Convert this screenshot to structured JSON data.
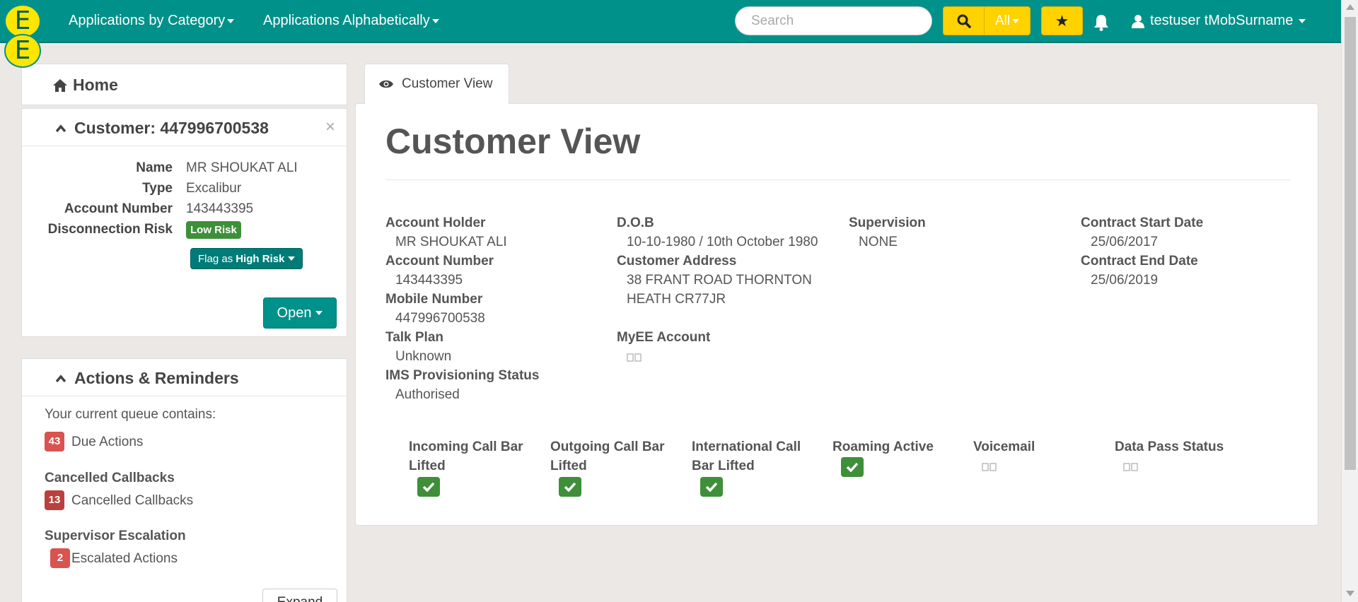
{
  "navbar": {
    "apps_by_category": "Applications by Category",
    "apps_alphabetically": "Applications Alphabetically",
    "search_placeholder": "Search",
    "search_scope": "All",
    "user_name": "testuser tMobSurname",
    "logo_letter": "E"
  },
  "home": {
    "label": "Home"
  },
  "customer": {
    "title": "Customer: 447996700538",
    "fields": [
      {
        "label": "Name",
        "value": "MR SHOUKAT ALI"
      },
      {
        "label": "Type",
        "value": "Excalibur"
      },
      {
        "label": "Account Number",
        "value": "143443395"
      },
      {
        "label": "Disconnection Risk",
        "value": "Low Risk"
      }
    ],
    "flag_prefix": "Flag as",
    "flag_strong": "High Risk",
    "open_label": "Open"
  },
  "actions": {
    "title": "Actions & Reminders",
    "intro": "Your current queue contains:",
    "due_count": "43",
    "due_label": "Due Actions",
    "cancelled_heading": "Cancelled Callbacks",
    "cancelled_count": "13",
    "cancelled_label": "Cancelled Callbacks",
    "supervisor_heading": "Supervisor Escalation",
    "escalated_count": "2",
    "escalated_label": "Escalated Actions",
    "expand_label": "Expand"
  },
  "tab": {
    "label": "Customer View"
  },
  "main": {
    "heading": "Customer View",
    "account_holder_label": "Account Holder",
    "account_holder_value": "MR SHOUKAT ALI",
    "account_number_label": "Account Number",
    "account_number_value": "143443395",
    "mobile_number_label": "Mobile Number",
    "mobile_number_value": "447996700538",
    "talk_plan_label": "Talk Plan",
    "talk_plan_value": "Unknown",
    "ims_label": "IMS Provisioning Status",
    "ims_value": "Authorised",
    "dob_label": "D.O.B",
    "dob_value": "10-10-1980 / 10th October 1980",
    "address_label": "Customer Address",
    "address_line1": "38 FRANT ROAD THORNTON",
    "address_line2": "HEATH CR77JR",
    "myee_label": "MyEE Account",
    "supervision_label": "Supervision",
    "supervision_value": "NONE",
    "contract_start_label": "Contract Start Date",
    "contract_start_value": "25/06/2017",
    "contract_end_label": "Contract End Date",
    "contract_end_value": "25/06/2019"
  },
  "statuses": [
    {
      "label": "Incoming Call Bar Lifted",
      "state": "checked"
    },
    {
      "label": "Outgoing Call Bar Lifted",
      "state": "checked"
    },
    {
      "label": "International Call Bar Lifted",
      "state": "checked"
    },
    {
      "label": "Roaming Active",
      "state": "checked"
    },
    {
      "label": "Voicemail",
      "state": "image-missing"
    },
    {
      "label": "Data Pass Status",
      "state": "image-missing"
    }
  ],
  "colors": {
    "brand_teal": "#00918a",
    "brand_yellow": "#ffd200",
    "success_green": "#3f8f3a",
    "danger_red": "#d9534f"
  }
}
